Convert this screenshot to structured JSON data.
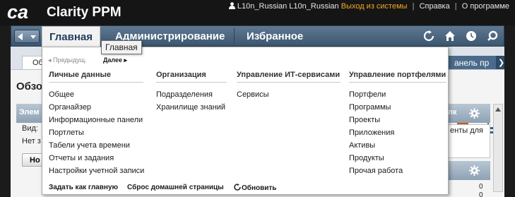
{
  "app": {
    "logo_text": "ca",
    "title": "Clarity PPM"
  },
  "user_nav": {
    "user": "L10n_Russian L10n_Russian",
    "logout": "Выход из системы",
    "help": "Справка",
    "about": "О программе"
  },
  "nav": {
    "tabs": [
      {
        "label": "Главная",
        "active": true
      },
      {
        "label": "Администрирование",
        "active": false
      },
      {
        "label": "Избранное",
        "active": false
      }
    ],
    "icons": [
      "refresh-icon",
      "home-icon",
      "clock-icon",
      "search-icon"
    ]
  },
  "tooltip": "Главная",
  "dropdown": {
    "prev": "◂ Предыдущ.",
    "next": "Далее ▸",
    "columns": [
      {
        "header": "Личные данные",
        "items": [
          "Общее",
          "Органайзер",
          "Информационные панели",
          "Портлеты",
          "Табели учета времени",
          "Отчеты и задания",
          "Настройки учетной записи"
        ]
      },
      {
        "header": "Организация",
        "items": [
          "Подразделения",
          "Хранилище знаний"
        ]
      },
      {
        "header": "Управление ИТ-сервисами",
        "items": [
          "Сервисы"
        ]
      },
      {
        "header": "Управление портфелями",
        "items": [
          "Портфели",
          "Программы",
          "Проекты",
          "Приложения",
          "Активы",
          "Продукты",
          "Прочая работа"
        ]
      }
    ],
    "footer": {
      "set_home": "Задать как главную",
      "reset_home": "Сброс домашней страницы",
      "refresh": "Обновить"
    }
  },
  "background": {
    "tab": "Об",
    "right_tab": "анель пр",
    "title": "Обзо",
    "portlet_header": "Элем",
    "view_label": "Вид:",
    "none_label": "Нет з",
    "button": "Но",
    "right_portlet_header": "лк",
    "right_text": "енты для",
    "right_values": [
      "0",
      "0"
    ]
  },
  "colors": {
    "accent": "#f5a623",
    "nav": "#4b6680",
    "brand": "#ffffff"
  }
}
